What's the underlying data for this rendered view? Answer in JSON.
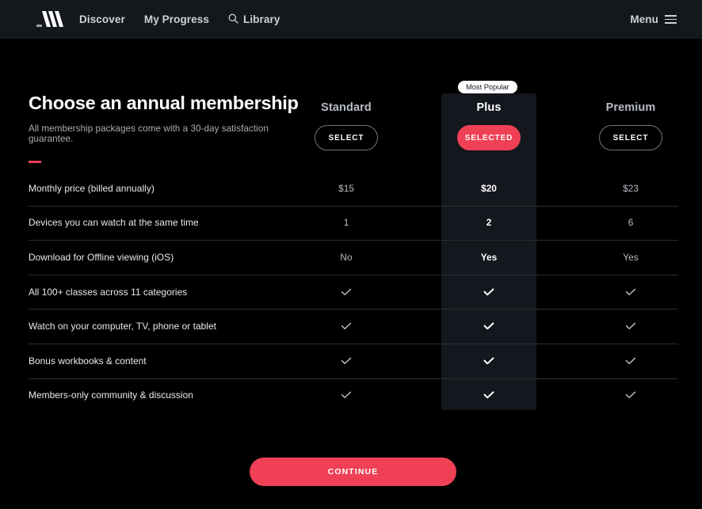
{
  "header": {
    "logo_name": "masterclass-logo",
    "nav": [
      {
        "label": "Discover",
        "icon": null
      },
      {
        "label": "My Progress",
        "icon": null
      },
      {
        "label": "Library",
        "icon": "search-icon"
      }
    ],
    "menu_label": "Menu",
    "menu_icon": "hamburger-icon"
  },
  "intro": {
    "title": "Choose an annual membership",
    "subtitle": "All membership packages come with a 30-day satisfaction guarantee."
  },
  "plans": [
    {
      "name": "Standard",
      "button_label": "SELECT",
      "selected": false,
      "badge": null
    },
    {
      "name": "Plus",
      "button_label": "SELECTED",
      "selected": true,
      "badge": "Most Popular"
    },
    {
      "name": "Premium",
      "button_label": "SELECT",
      "selected": false,
      "badge": null
    }
  ],
  "features": [
    {
      "label": "Monthly price (billed annually)",
      "values": [
        "$15",
        "$20",
        "$23"
      ],
      "type": "text"
    },
    {
      "label": "Devices you can watch at the same time",
      "values": [
        "1",
        "2",
        "6"
      ],
      "type": "text"
    },
    {
      "label": "Download for Offline viewing (iOS)",
      "values": [
        "No",
        "Yes",
        "Yes"
      ],
      "type": "text"
    },
    {
      "label": "All 100+ classes across 11 categories",
      "values": [
        "check",
        "check",
        "check"
      ],
      "type": "check"
    },
    {
      "label": "Watch on your computer, TV, phone or tablet",
      "values": [
        "check",
        "check",
        "check"
      ],
      "type": "check"
    },
    {
      "label": "Bonus workbooks & content",
      "values": [
        "check",
        "check",
        "check"
      ],
      "type": "check"
    },
    {
      "label": "Members-only community & discussion",
      "values": [
        "check",
        "check",
        "check"
      ],
      "type": "check"
    }
  ],
  "footer": {
    "continue_label": "CONTINUE"
  },
  "colors": {
    "accent": "#ef4056",
    "page_background": "#000000",
    "header_background": "#14181d",
    "highlight_column": "#14171d",
    "divider": "#2b2e33"
  }
}
